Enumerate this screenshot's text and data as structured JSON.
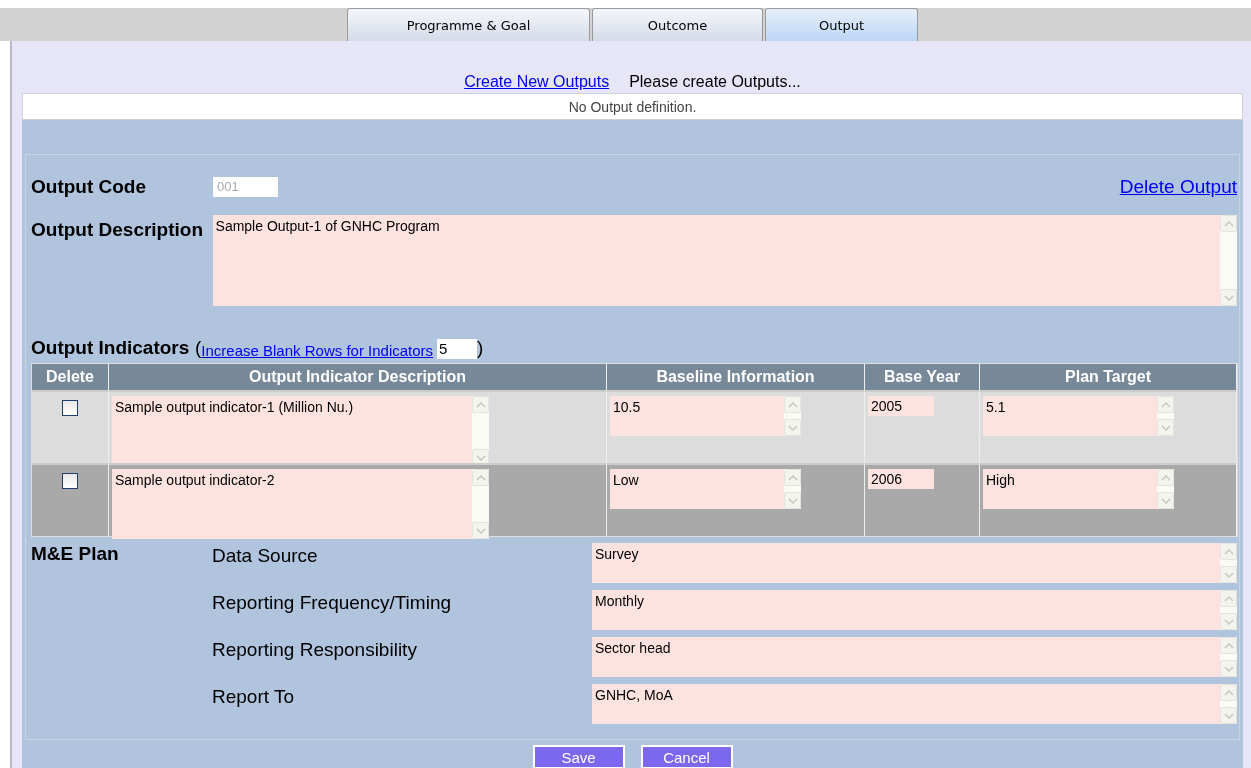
{
  "tabs": [
    {
      "label": "Programme & Goal",
      "selected": false
    },
    {
      "label": "Outcome",
      "selected": false
    },
    {
      "label": "Output",
      "selected": true
    }
  ],
  "create_link": "Create New Outputs",
  "create_hint": "Please create Outputs...",
  "notice": "No Output definition.",
  "output_code": {
    "label": "Output Code",
    "value": "001",
    "disabled": true
  },
  "delete_link": "Delete Output",
  "description": {
    "label": "Output Description",
    "value": "Sample Output-1 of GNHC Program"
  },
  "indicators": {
    "label": "Output Indicators",
    "open_paren": "(",
    "link": "Increase Blank Rows for Indicators",
    "rows_value": "5",
    "close_paren": ")"
  },
  "table": {
    "columns": [
      "Delete",
      "Output Indicator Description",
      "Baseline Information",
      "Base Year",
      "Plan Target"
    ],
    "rows": [
      {
        "checked": false,
        "description": "Sample output indicator-1 (Million Nu.)",
        "baseline": "10.5",
        "base_year": "2005",
        "plan_target": "5.1"
      },
      {
        "checked": false,
        "description": "Sample output indicator-2",
        "baseline": "Low",
        "base_year": "2006",
        "plan_target": "High"
      }
    ]
  },
  "me_plan": {
    "label": "M&E Plan",
    "items": [
      {
        "label": "Data Source",
        "value": "Survey"
      },
      {
        "label": "Reporting Frequency/Timing",
        "value": "Monthly"
      },
      {
        "label": "Reporting Responsibility",
        "value": "Sector head"
      },
      {
        "label": "Report To",
        "value": "GNHC, MoA"
      }
    ]
  },
  "buttons": [
    "Save",
    "Cancel"
  ]
}
